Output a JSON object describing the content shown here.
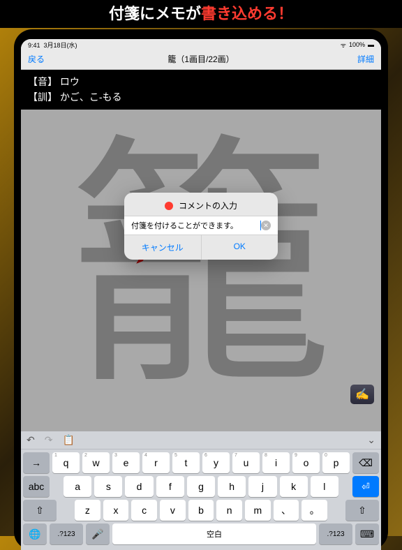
{
  "promo": {
    "pre": "付箋にメモが",
    "hl": "書き込める！"
  },
  "status": {
    "time": "9:41",
    "date": "3月18日(水)",
    "battery": "100%"
  },
  "nav": {
    "back": "戻る",
    "title": "籠（1画目/22画）",
    "detail": "詳細"
  },
  "readings": {
    "on_label": "【音】",
    "on": "ロウ",
    "kun_label": "【訓】",
    "kun": "かご、こ-もる"
  },
  "kanji": "籠",
  "note_icon": "✍️",
  "dialog": {
    "title": "コメントの入力",
    "value": "付箋を付けることができます。",
    "cancel": "キャンセル",
    "ok": "OK"
  },
  "kbd": {
    "toolbar": {
      "undo": "↶",
      "redo": "↷",
      "paste": "📋",
      "hide": "⌨"
    },
    "row1_nums": [
      "1",
      "2",
      "3",
      "4",
      "5",
      "6",
      "7",
      "8",
      "9",
      "0"
    ],
    "row1": [
      "q",
      "w",
      "e",
      "r",
      "t",
      "y",
      "u",
      "i",
      "o",
      "p"
    ],
    "row2_left": "→",
    "row2": [
      "a",
      "s",
      "d",
      "f",
      "g",
      "h",
      "j",
      "k",
      "l"
    ],
    "row3_left": "abc",
    "row3_shift": "⇧",
    "row3": [
      "z",
      "x",
      "c",
      "v",
      "b",
      "n",
      "m"
    ],
    "backspace": "⌫",
    "enter": "⏎",
    "bottom": {
      "globe": "🌐",
      "num": ".?123",
      "mic": "🎤",
      "space": "空白",
      "num2": ".?123",
      "hide": "⌨"
    }
  }
}
